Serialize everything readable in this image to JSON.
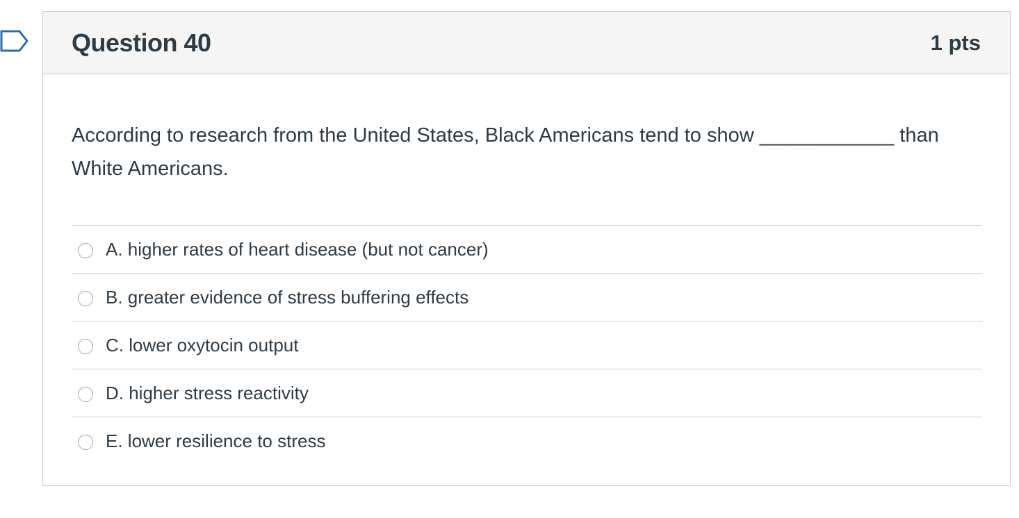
{
  "question": {
    "title": "Question 40",
    "points": "1 pts",
    "text": "According to research from the United States, Black Americans tend to show ____________ than White Americans.",
    "answers": [
      {
        "label": "A. higher rates of heart disease (but not cancer)",
        "selected": false
      },
      {
        "label": "B. greater evidence of stress buffering effects",
        "selected": false
      },
      {
        "label": "C. lower oxytocin output",
        "selected": false
      },
      {
        "label": "D. higher stress reactivity",
        "selected": false
      },
      {
        "label": "E. lower resilience to stress",
        "selected": false
      }
    ]
  },
  "colors": {
    "text": "#2d3b45",
    "border": "#c7cdd1",
    "header_bg": "#f5f5f5",
    "flag": "#2b6cb0"
  },
  "icons": {
    "flag": "bookmark-flag-icon"
  }
}
